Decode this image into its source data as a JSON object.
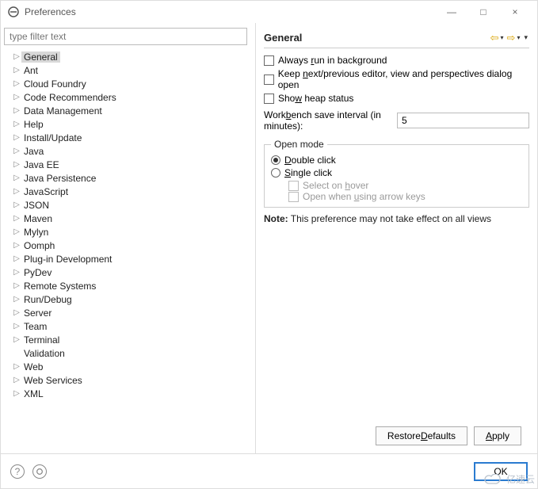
{
  "window": {
    "title": "Preferences",
    "minimize": "—",
    "maximize": "□",
    "close": "×"
  },
  "filter": {
    "placeholder": "type filter text"
  },
  "tree": {
    "items": [
      {
        "label": "General",
        "expandable": true,
        "selected": true
      },
      {
        "label": "Ant",
        "expandable": true
      },
      {
        "label": "Cloud Foundry",
        "expandable": true
      },
      {
        "label": "Code Recommenders",
        "expandable": true
      },
      {
        "label": "Data Management",
        "expandable": true
      },
      {
        "label": "Help",
        "expandable": true
      },
      {
        "label": "Install/Update",
        "expandable": true
      },
      {
        "label": "Java",
        "expandable": true
      },
      {
        "label": "Java EE",
        "expandable": true
      },
      {
        "label": "Java Persistence",
        "expandable": true
      },
      {
        "label": "JavaScript",
        "expandable": true
      },
      {
        "label": "JSON",
        "expandable": true
      },
      {
        "label": "Maven",
        "expandable": true
      },
      {
        "label": "Mylyn",
        "expandable": true
      },
      {
        "label": "Oomph",
        "expandable": true
      },
      {
        "label": "Plug-in Development",
        "expandable": true
      },
      {
        "label": "PyDev",
        "expandable": true
      },
      {
        "label": "Remote Systems",
        "expandable": true
      },
      {
        "label": "Run/Debug",
        "expandable": true
      },
      {
        "label": "Server",
        "expandable": true
      },
      {
        "label": "Team",
        "expandable": true
      },
      {
        "label": "Terminal",
        "expandable": true
      },
      {
        "label": "Validation",
        "expandable": false
      },
      {
        "label": "Web",
        "expandable": true
      },
      {
        "label": "Web Services",
        "expandable": true
      },
      {
        "label": "XML",
        "expandable": true
      }
    ]
  },
  "page": {
    "title": "General",
    "checkboxes": {
      "bg_pre": "Always ",
      "bg_u": "r",
      "bg_post": "un in background",
      "keep_pre": "Keep ",
      "keep_u": "n",
      "keep_post": "ext/previous editor, view and perspectives dialog open",
      "heap_pre": "Sho",
      "heap_u": "w",
      "heap_post": " heap status"
    },
    "interval_pre": "Work",
    "interval_u": "b",
    "interval_post": "ench save interval (in minutes):",
    "interval_value": "5",
    "open_mode": {
      "legend": "Open mode",
      "double_u": "D",
      "double_post": "ouble click",
      "single_u": "S",
      "single_post": "ingle click",
      "hover_pre": "Select on ",
      "hover_u": "h",
      "hover_post": "over",
      "arrow_pre": "Open when ",
      "arrow_u": "u",
      "arrow_post": "sing arrow keys"
    },
    "note_label": "Note:",
    "note_text": " This preference may not take effect on all views",
    "restore_pre": "Restore ",
    "restore_u": "D",
    "restore_post": "efaults",
    "apply_u": "A",
    "apply_post": "pply"
  },
  "footer": {
    "ok": "OK",
    "help": "?"
  },
  "watermark": "亿速云"
}
